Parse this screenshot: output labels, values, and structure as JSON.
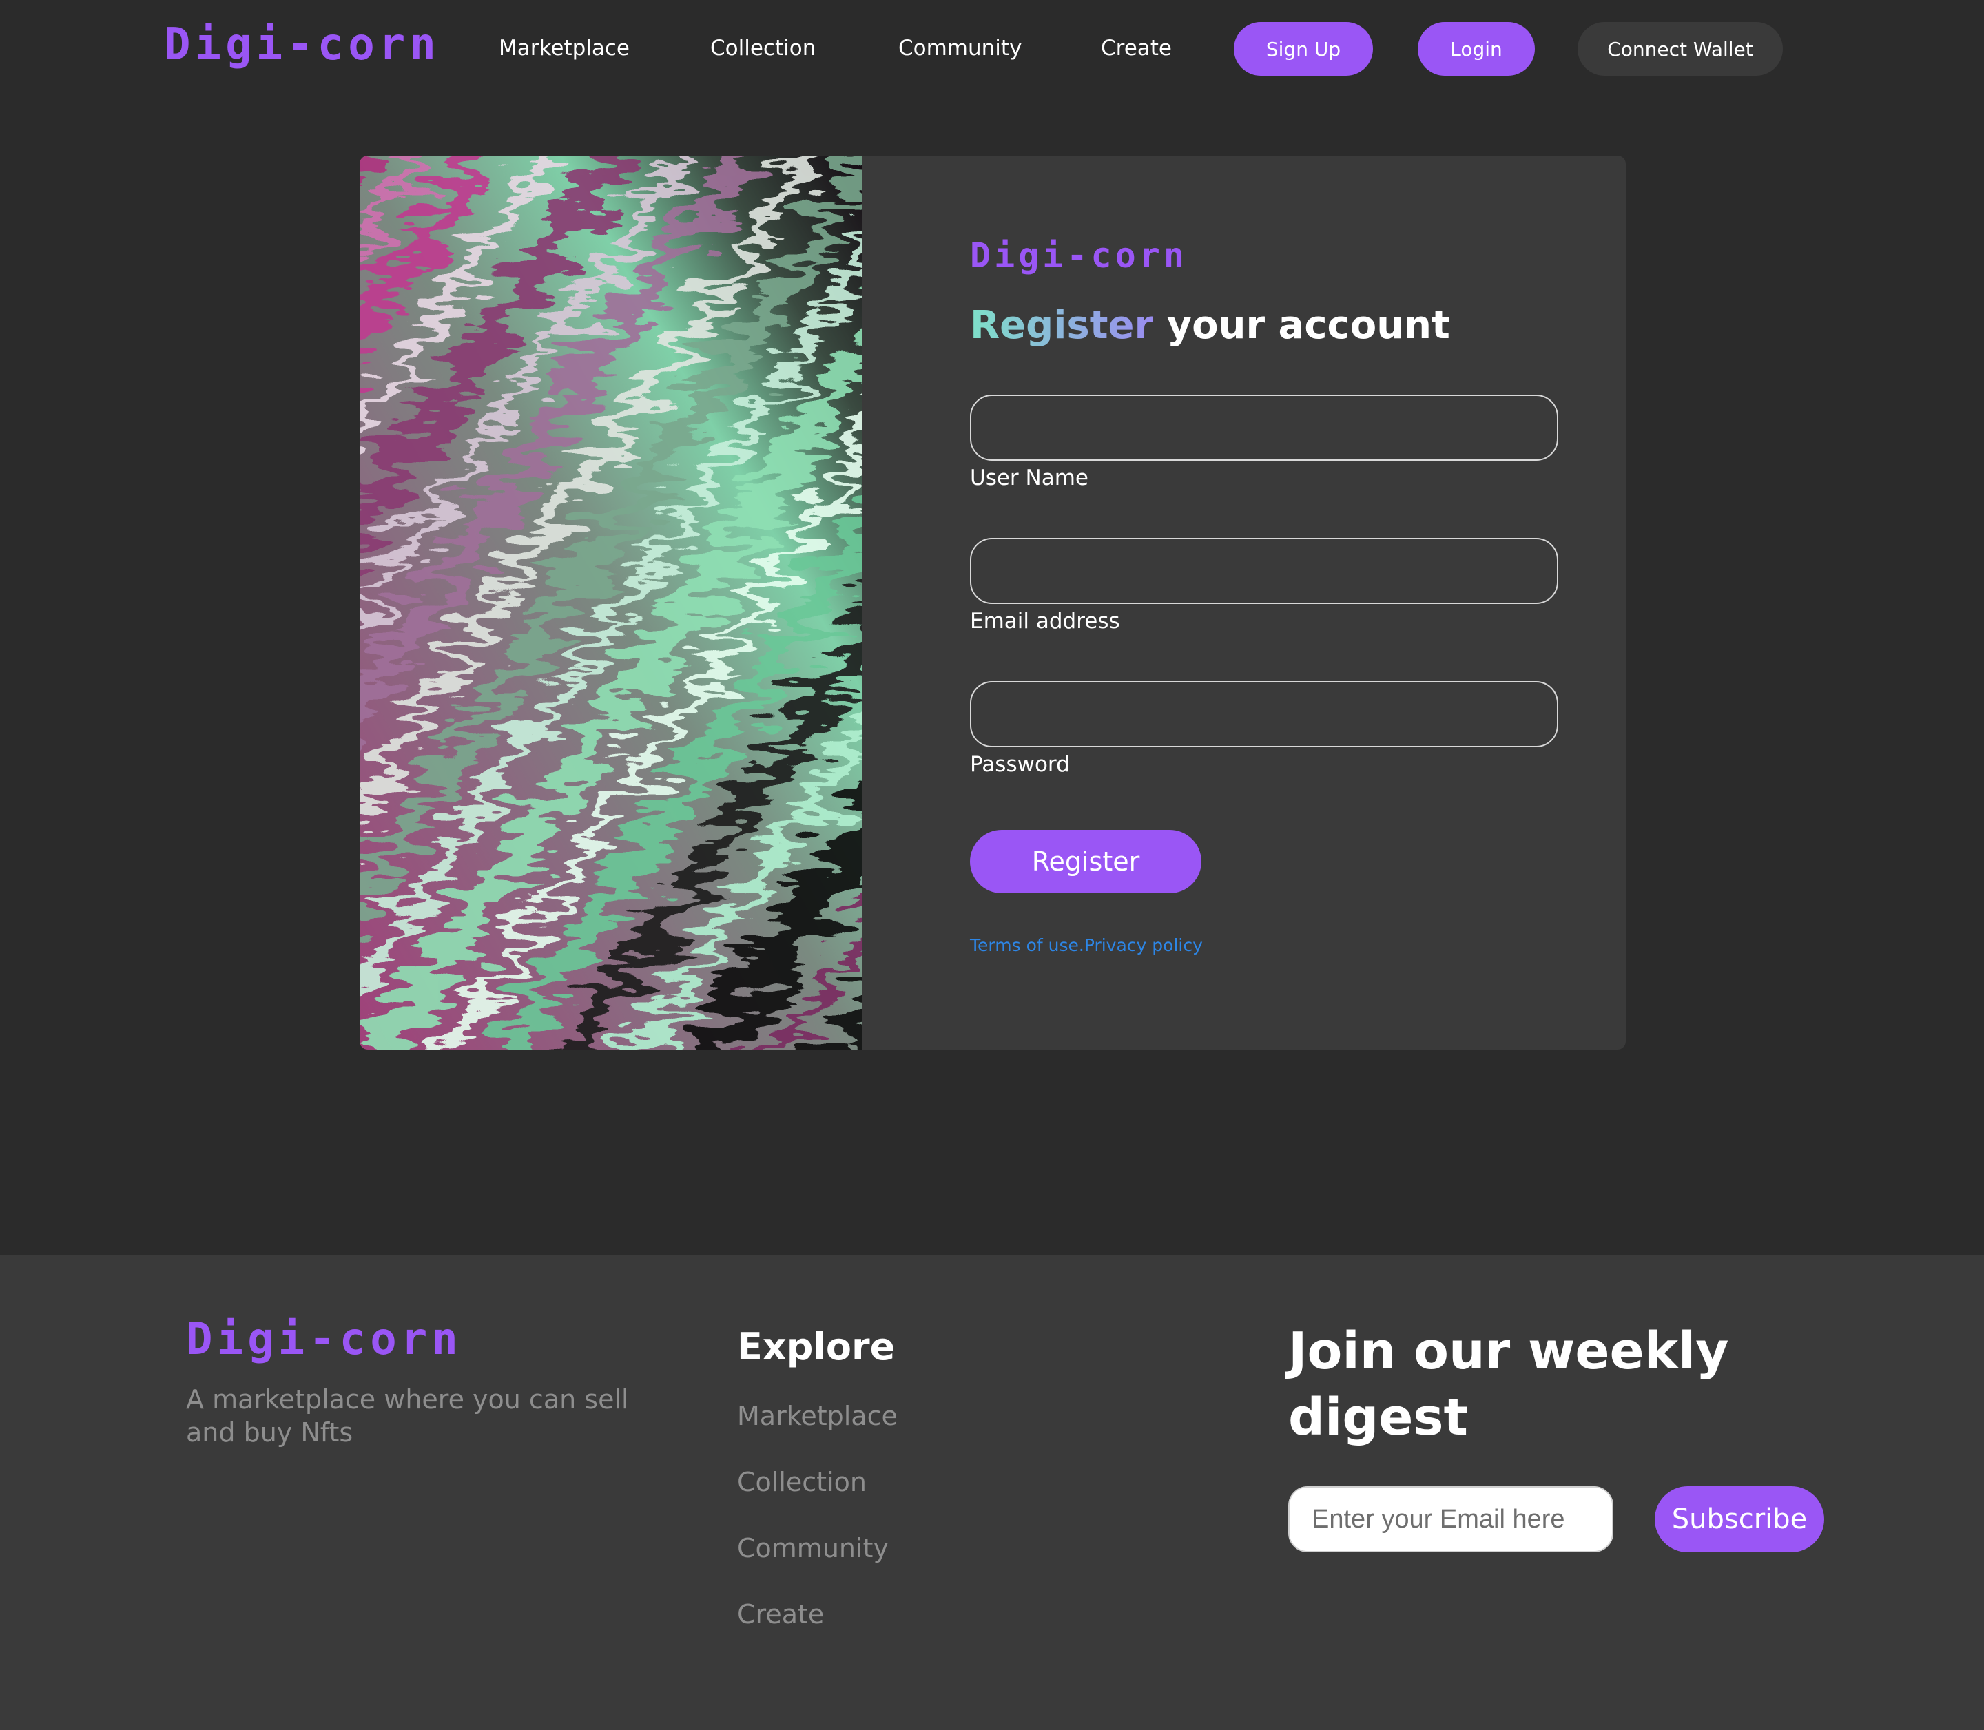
{
  "brand": {
    "name": "Digi-corn",
    "accent_color": "#9a56f5"
  },
  "header": {
    "nav": [
      "Marketplace",
      "Collection",
      "Community",
      "Create"
    ],
    "signup_label": "Sign Up",
    "login_label": "Login",
    "wallet_label": "Connect Wallet"
  },
  "register_form": {
    "title_accent": "Register",
    "title_rest": "your account",
    "fields": [
      {
        "label": "User Name",
        "value": ""
      },
      {
        "label": "Email address",
        "value": ""
      },
      {
        "label": "Password",
        "value": ""
      }
    ],
    "submit_label": "Register",
    "terms_label": "Terms of use.",
    "privacy_label": "Privacy policy"
  },
  "footer": {
    "tagline": "A marketplace where you can sell and buy Nfts",
    "explore_heading": "Explore",
    "explore_links": [
      "Marketplace",
      "Collection",
      "Community",
      "Create"
    ],
    "digest_heading": "Join our weekly digest",
    "email_placeholder": "Enter your Email here",
    "subscribe_label": "Subscribe"
  }
}
